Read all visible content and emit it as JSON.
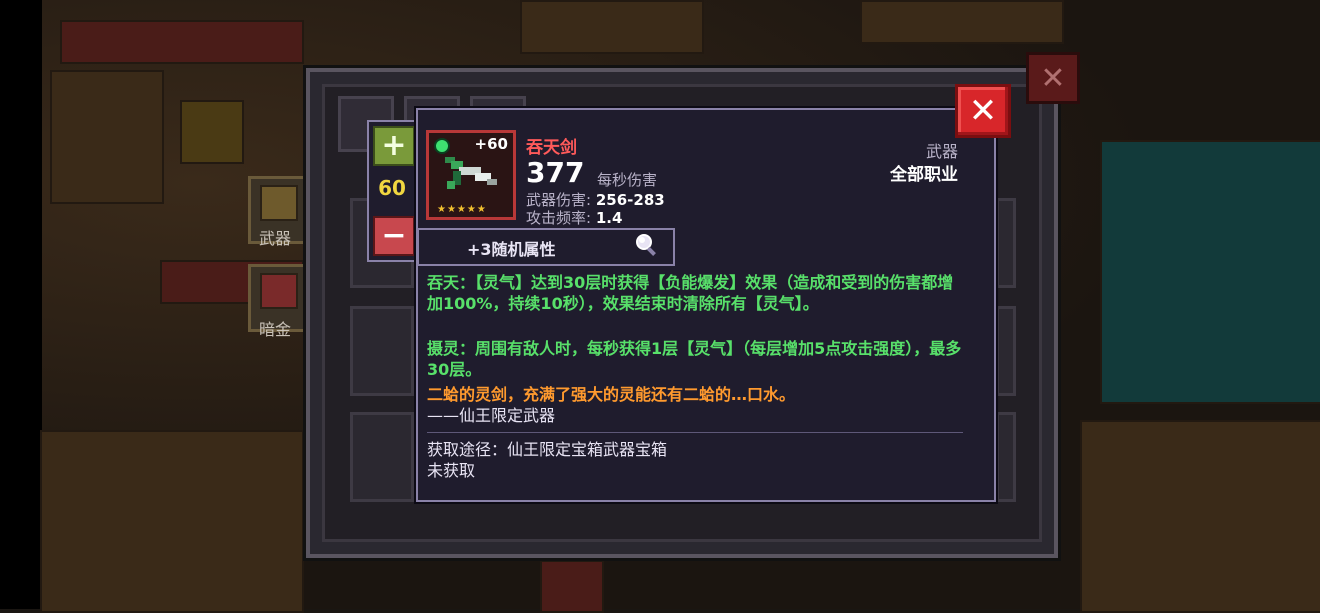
{
  "weapon": {
    "name": "吞天剑",
    "enhance": "+60",
    "stars": "★★★★★",
    "dps": "377",
    "dps_label": "每秒伤害",
    "damage_label": "武器伤害:",
    "damage_value": "256-283",
    "rate_label": "攻击频率:",
    "rate_value": "1.4",
    "type": "武器",
    "class": "全部职业"
  },
  "level": {
    "value": "60",
    "plus": "+",
    "minus": "−"
  },
  "random_attr": "+3随机属性",
  "description": {
    "skill1": "吞天：【灵气】达到30层时获得【负能爆发】效果（造成和受到的伤害都增加100%，持续10秒），效果结束时清除所有【灵气】。",
    "skill2": "摄灵：周围有敌人时，每秒获得1层【灵气】（每层增加5点攻击强度），最多30层。",
    "flavor": "二蛤的灵剑，充满了强大的灵能还有二蛤的…口水。",
    "limited": "——仙王限定武器",
    "source": "获取途径：仙王限定宝箱武器宝箱",
    "status": "未获取"
  },
  "side_menu": {
    "weapon_label": "武器",
    "darkgold_label": "暗金"
  },
  "close_label": "✕",
  "colors": {
    "name": "#ff5a5a",
    "skill": "#58e06a",
    "flavor": "#ff9a2e",
    "level": "#f0d640"
  }
}
